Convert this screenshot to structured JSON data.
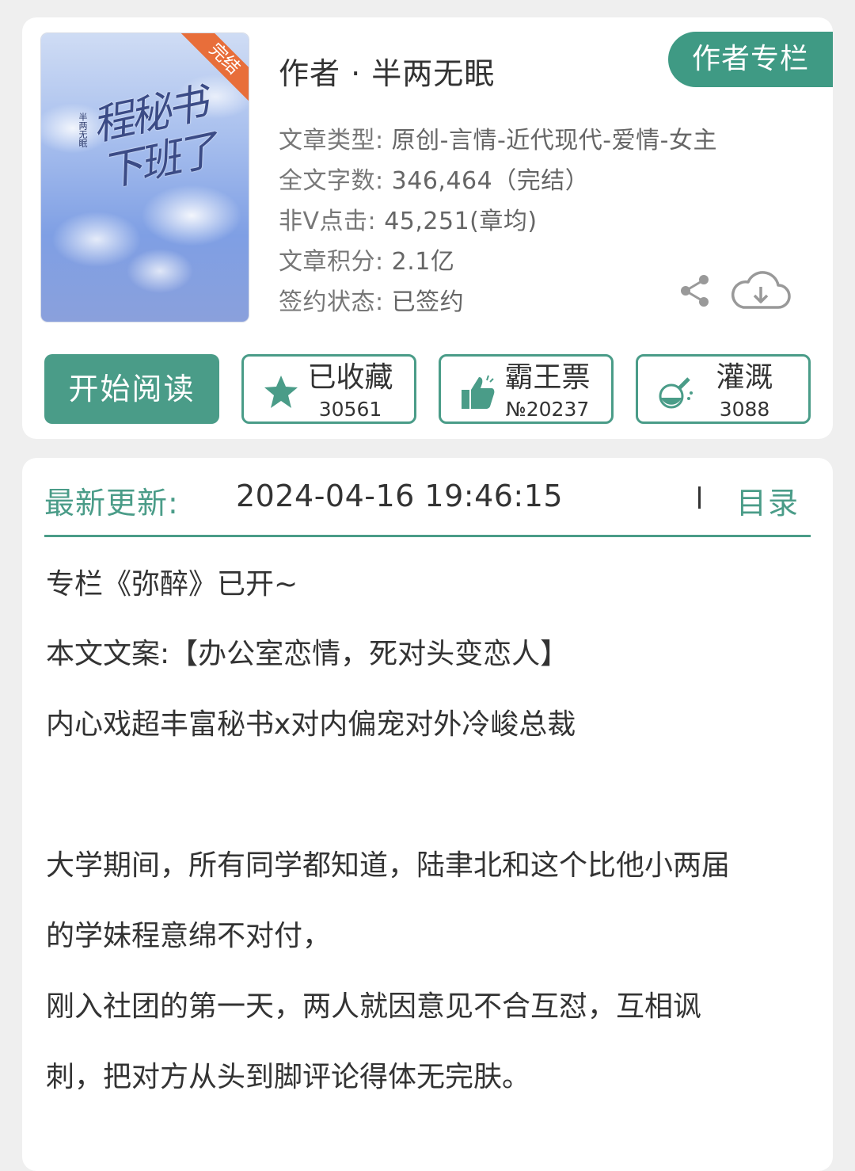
{
  "book": {
    "cover_title": "程秘书下班了",
    "cover_author": "半两无眠",
    "status_ribbon": "完结",
    "author_line": "作者 · 半两无眠",
    "author_column_button": "作者专栏",
    "meta": [
      {
        "key": "文章类型:",
        "value": "原创-言情-近代现代-爱情-女主"
      },
      {
        "key": "全文字数:",
        "value": "346,464（完结）"
      },
      {
        "key": "非V点击:",
        "value": "45,251(章均)"
      },
      {
        "key": "文章积分:",
        "value": "2.1亿"
      },
      {
        "key": "签约状态:",
        "value": "已签约"
      }
    ]
  },
  "actions": {
    "read_label": "开始阅读",
    "collect": {
      "label": "已收藏",
      "count": "30561",
      "icon": "star-icon"
    },
    "vote": {
      "label": "霸王票",
      "count": "№20237",
      "icon": "thumbs-up-icon"
    },
    "water": {
      "label": "灌溉",
      "count": "3088",
      "icon": "watering-flask-icon"
    }
  },
  "update": {
    "label": "最新更新:",
    "time": "2024-04-16 19:46:15",
    "toc_label": "目录"
  },
  "intro": {
    "lines": [
      "专栏《弥醉》已开~",
      "本文文案:【办公室恋情，死对头变恋人】",
      "内心戏超丰富秘书x对内偏宠对外冷峻总裁",
      "",
      "大学期间，所有同学都知道，陆聿北和这个比他小两届",
      "的学妹程意绵不对付，",
      "刚入社团的第一天，两人就因意见不合互怼，互相讽",
      "刺，把对方从头到脚评论得体无完肤。"
    ]
  },
  "colors": {
    "accent": "#4a9c88",
    "ribbon": "#e86e3a"
  }
}
